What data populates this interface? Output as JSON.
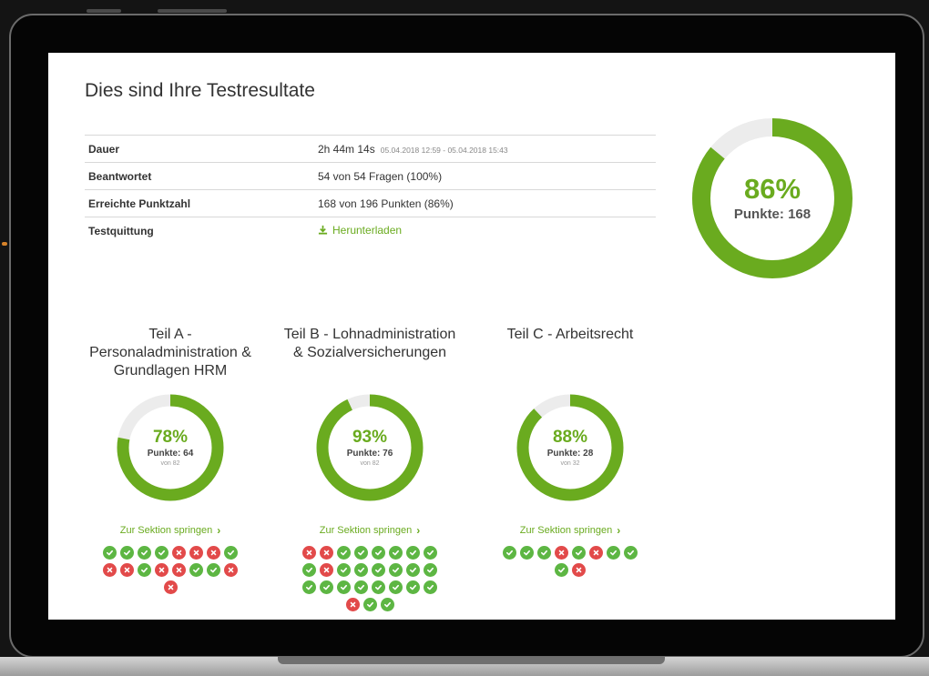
{
  "page": {
    "title": "Dies sind Ihre Testresultate",
    "accent_color": "#6aab1f",
    "ok_color": "#5db643",
    "fail_color": "#e24a4a"
  },
  "summary": {
    "rows": [
      {
        "label": "Dauer",
        "value": "2h 44m 14s",
        "sub": "05.04.2018 12:59 - 05.04.2018 15:43"
      },
      {
        "label": "Beantwortet",
        "value": "54 von 54 Fragen (100%)"
      },
      {
        "label": "Erreichte Punktzahl",
        "value": "168 von 196 Punkten (86%)"
      },
      {
        "label": "Testquittung",
        "link": "Herunterladen",
        "icon": "download-icon"
      }
    ]
  },
  "overall": {
    "percent": "86%",
    "fraction": 0.86,
    "points": "Punkte: 168"
  },
  "sections": [
    {
      "title": "Teil A - Personaladministration & Grundlagen HRM",
      "percent": "78%",
      "fraction": 0.78,
      "points": "Punkte: 64",
      "von": "von 82",
      "link": "Zur Sektion springen",
      "results": [
        "ok",
        "ok",
        "ok",
        "ok",
        "fail",
        "fail",
        "fail",
        "ok",
        "fail",
        "fail",
        "ok",
        "fail",
        "fail",
        "ok",
        "ok",
        "fail",
        "fail"
      ]
    },
    {
      "title": "Teil B - Lohnadministration & Sozialversicherungen",
      "percent": "93%",
      "fraction": 0.93,
      "points": "Punkte: 76",
      "von": "von 82",
      "link": "Zur Sektion springen",
      "results": [
        "fail",
        "fail",
        "ok",
        "ok",
        "ok",
        "ok",
        "ok",
        "ok",
        "ok",
        "fail",
        "ok",
        "ok",
        "ok",
        "ok",
        "ok",
        "ok",
        "ok",
        "ok",
        "ok",
        "ok",
        "ok",
        "ok",
        "ok",
        "ok",
        "fail",
        "ok",
        "ok"
      ]
    },
    {
      "title": "Teil C - Arbeitsrecht",
      "percent": "88%",
      "fraction": 0.88,
      "points": "Punkte: 28",
      "von": "von 32",
      "link": "Zur Sektion springen",
      "results": [
        "ok",
        "ok",
        "ok",
        "fail",
        "ok",
        "fail",
        "ok",
        "ok",
        "ok",
        "fail"
      ]
    }
  ]
}
